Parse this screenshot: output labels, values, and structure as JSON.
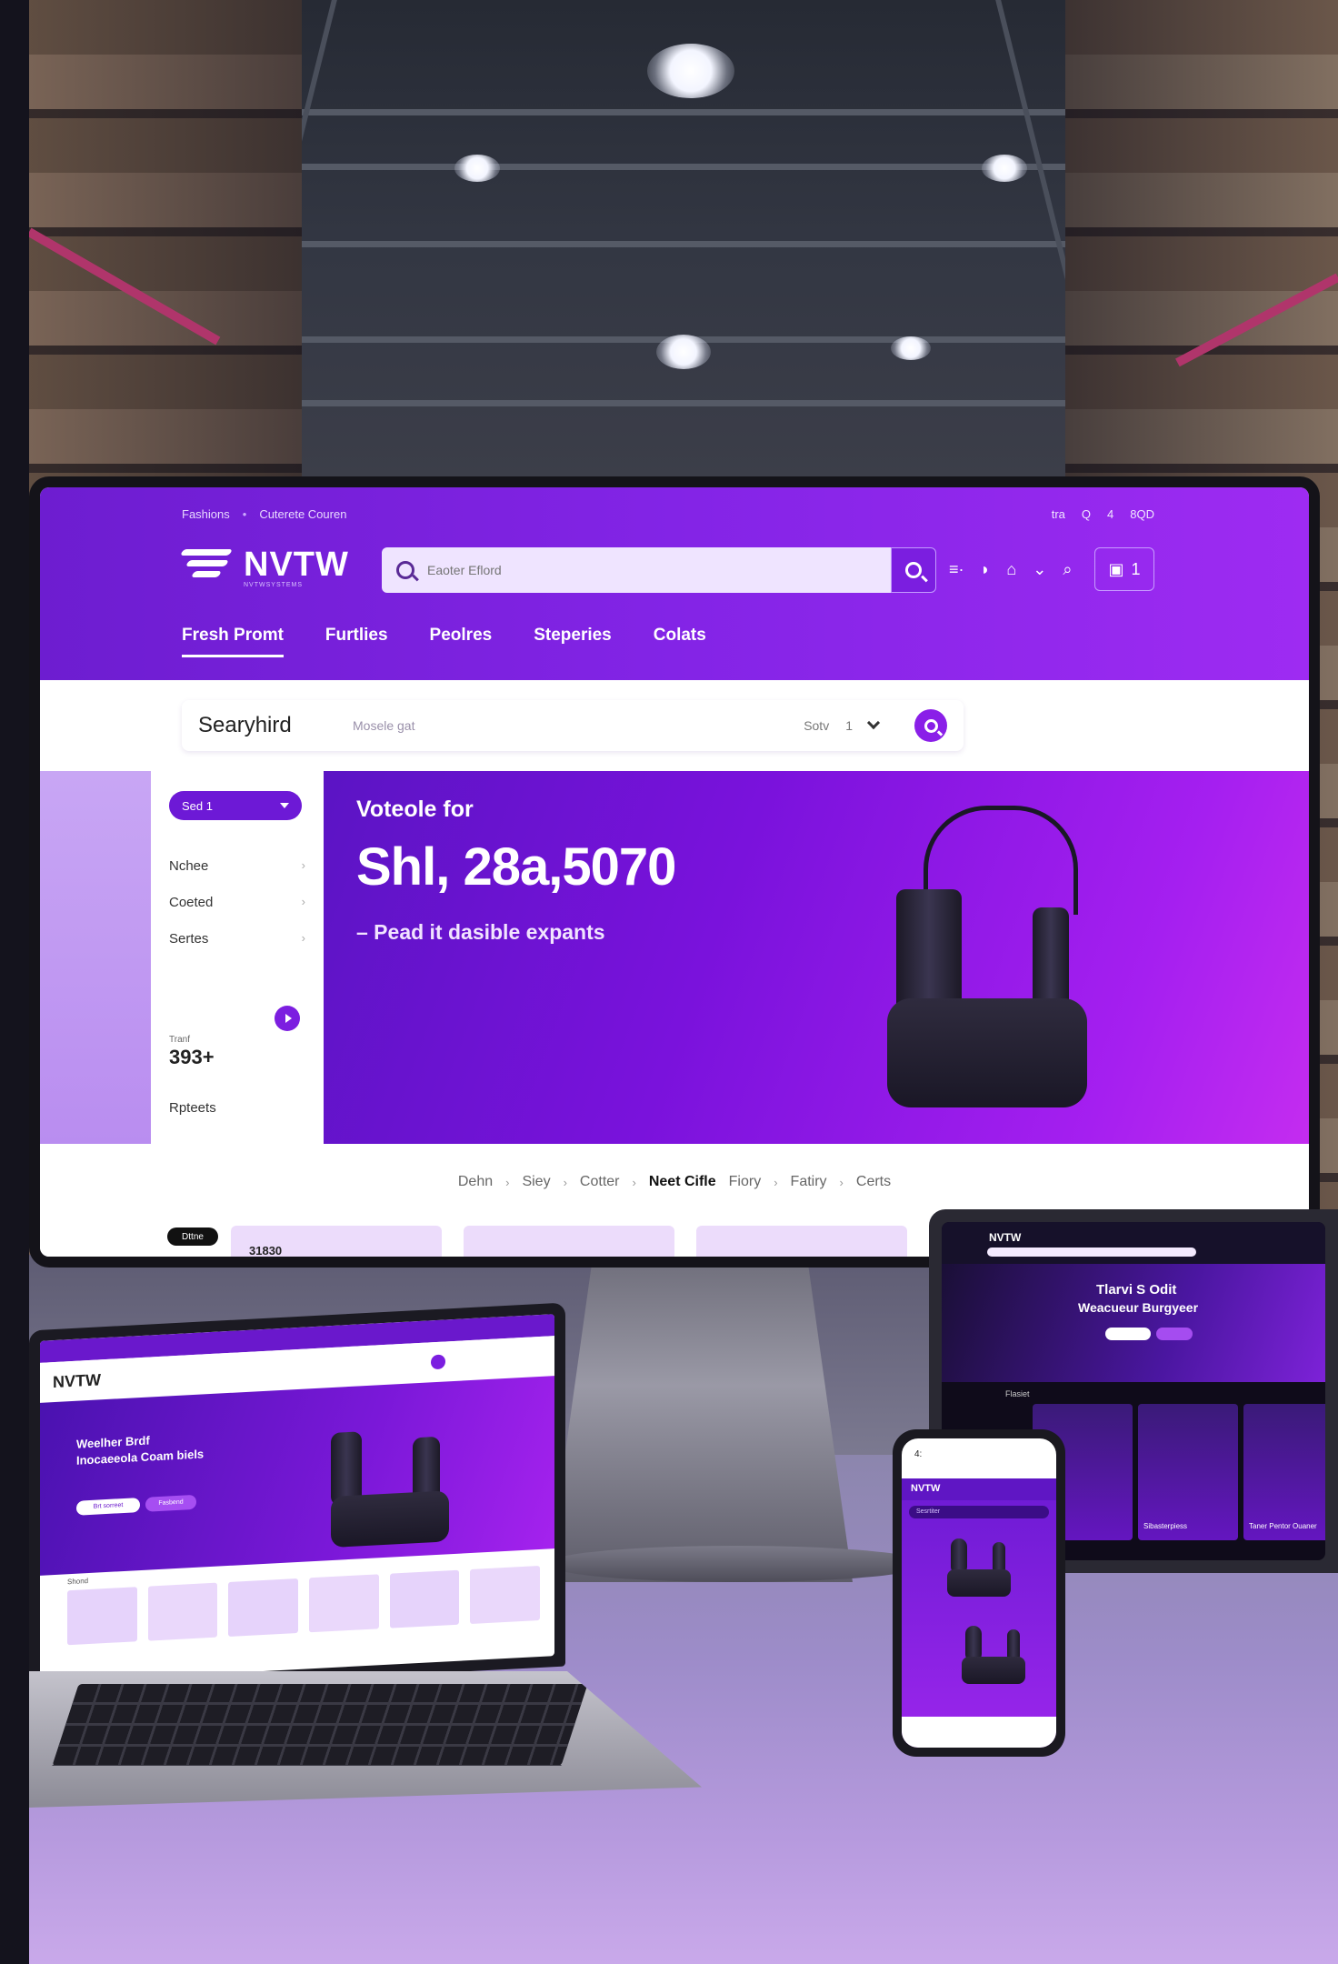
{
  "colors": {
    "brand_purple": "#7b1ee0",
    "brand_violet": "#a51ff0",
    "header_gradient_start": "#6d1dd0",
    "accent_light": "#efe4ff"
  },
  "monitor": {
    "topbar": {
      "left_links": [
        "Fashions",
        "Cuterete Couren"
      ],
      "right_items": [
        "tra",
        "Q",
        "4",
        "8QD"
      ]
    },
    "brand": {
      "name": "NVTW",
      "tagline": "NVTWSYSTEMS"
    },
    "search": {
      "placeholder": "Eaoter Eflord"
    },
    "header_icons": [
      "user-icon",
      "bell-icon",
      "lock-icon",
      "chevron-down-icon",
      "wishlist-icon"
    ],
    "cart": {
      "count": "1"
    },
    "nav_tabs": [
      {
        "label": "Fresh Promt",
        "active": true
      },
      {
        "label": "Furtlies",
        "active": false
      },
      {
        "label": "Peolres",
        "active": false
      },
      {
        "label": "Steperies",
        "active": false
      },
      {
        "label": "Colats",
        "active": false
      }
    ],
    "filter": {
      "title": "Searyhird",
      "hint": "Mosele gat",
      "sort_label": "Sotv",
      "sort_value": "1"
    },
    "sidebar": {
      "select_label": "Sed 1",
      "items": [
        "Nchee",
        "Coeted",
        "Sertes"
      ],
      "stat_label": "Tranf",
      "stat_value": "393+",
      "footer_link": "Rpteets"
    },
    "hero": {
      "kicker": "Voteole for",
      "title": "Shl, 28a,5070",
      "subtitle": "– Pead it dasible expants"
    },
    "breadcrumb": [
      "Dehn",
      "Siey",
      "Cotter",
      "Neet Cifle",
      "Fiory",
      "Fatiry",
      "Certs"
    ],
    "breadcrumb_highlight": "Neet Cifle",
    "cards": {
      "badge": "Dttne",
      "first_price": "31830"
    }
  },
  "laptop": {
    "brand": "NVTW",
    "hero_line1": "Weelher Brdf",
    "hero_line2": "Inocaeeola Coam biels",
    "primary_button": "Brt sorreet",
    "secondary_button": "Fasbend",
    "section_label": "Shond"
  },
  "tablet": {
    "brand": "NVTW",
    "hero_line1": "Tlarvi S Odit",
    "hero_line2": "Weacueur Burgyeer",
    "section_label": "Flasiet",
    "product_captions": [
      "Sibasterpiess",
      "Taner Pentor Ouaner"
    ]
  },
  "phone": {
    "time": "4:",
    "brand": "NVTW",
    "search_placeholder": "Sesrtiter"
  }
}
